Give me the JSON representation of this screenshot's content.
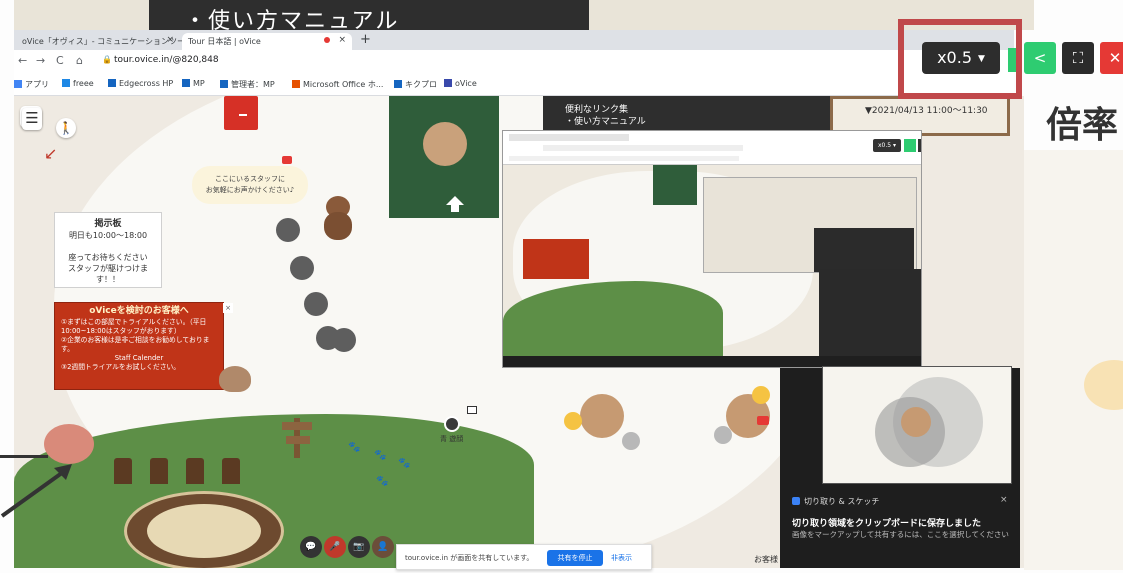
{
  "slide": {
    "top_title": "・使い方マニュアル",
    "side_title": "倍率"
  },
  "browser": {
    "tabs": [
      {
        "label": "oVice「オヴィス」- コミュニケーションツール"
      },
      {
        "label": "Tour 日本語 | oVice"
      }
    ],
    "new_tab_symbol": "+",
    "close_symbol": "×",
    "nav": {
      "back": "←",
      "forward": "→",
      "reload": "C",
      "home": "⌂"
    },
    "url": "tour.ovice.in/@820,848",
    "bookmarks": [
      {
        "label": "アプリ",
        "color": "#4285f4"
      },
      {
        "label": "freee",
        "color": "#1e88e5"
      },
      {
        "label": "Edgecross HP",
        "color": "#1565c0"
      },
      {
        "label": "MP",
        "color": "#1565c0"
      },
      {
        "label": "管理者：MP",
        "color": "#1565c0"
      },
      {
        "label": "Microsoft Office ホ...",
        "color": "#e65100"
      },
      {
        "label": "キクプロ",
        "color": "#1565c0"
      },
      {
        "label": "oVice",
        "color": "#3949ab"
      }
    ]
  },
  "ovice": {
    "controls": {
      "zoom_label": "x0.5",
      "zoom_caret": "▼",
      "share_icon": "<",
      "fullscreen_icon": "⛶",
      "close_icon": "✕"
    },
    "menu_icon": "☰",
    "walker_icon": "🚶",
    "speech_bubble": {
      "lines": [
        "ここにいるスタッフに",
        "お気軽にお声かけください♪"
      ]
    },
    "link_board": {
      "lines": [
        "便利なリンク集",
        "・使い方マニュアル"
      ]
    },
    "date_board": "▼2021/04/13 11:00～11:30",
    "info_board": {
      "title": "掲示板",
      "lines": [
        "明日も10:00～18:00",
        "",
        "座ってお待ちください",
        "スタッフが駆けつけま",
        "す！！"
      ]
    },
    "notice": {
      "title": "oViceを検討のお客様へ",
      "lines": [
        "①まずはこの部屋でトライアルください。（平日10:00~18:00はスタッフがおります）",
        "②企業のお客様は是非ご相談をお勧めしております。",
        "Staff Calender",
        "③2週間トライアルをお試しください。"
      ],
      "close": "×"
    },
    "avatar_name": "青 遊顔",
    "bottom_controls": [
      "💬",
      "🎤",
      "📷",
      "👤"
    ],
    "share_bar": {
      "text": "tour.ovice.in が画面を共有しています。",
      "stop_label": "共有を停止",
      "hide_label": "非表示"
    },
    "odesk_label": "お客様",
    "nested_zoom_label": "x0.5 ▾"
  },
  "snip_toast": {
    "app_name": "切り取り & スケッチ",
    "close": "×",
    "title": "切り取り領域をクリップボードに保存しました",
    "body": "画像をマークアップして共有するには、ここを選択してください"
  }
}
